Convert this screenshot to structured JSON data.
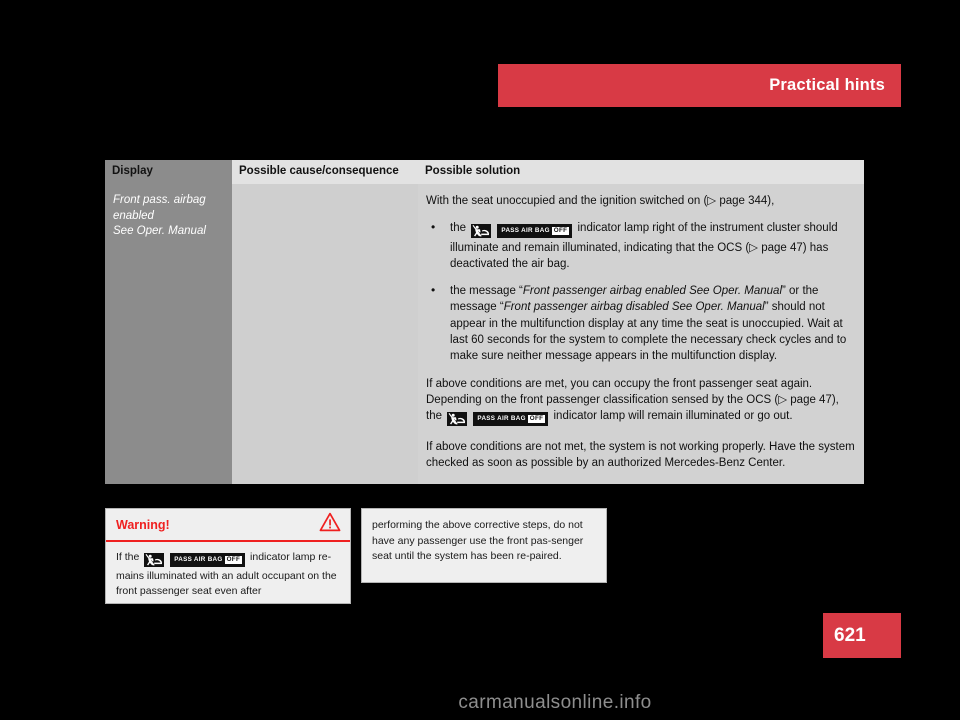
{
  "header": {
    "title": "Practical hints",
    "accent_color": "#d83a45"
  },
  "table": {
    "columns": [
      {
        "key": "display",
        "label": "Display"
      },
      {
        "key": "cause",
        "label": "Possible cause/consequence"
      },
      {
        "key": "solution",
        "label": "Possible solution"
      }
    ],
    "row": {
      "display": "Front pass. airbag enabled\nSee Oper. Manual",
      "display_lines": [
        "Front pass. airbag",
        "enabled",
        "See Oper. Manual"
      ],
      "cause": "",
      "solution": {
        "intro": "With the seat unoccupied and the ignition switched on (▷ page 344),",
        "bullets": [
          {
            "pre": "the",
            "icon": "pass-air-bag-off-indicator-lamp",
            "post": "indicator lamp right of the instrument cluster should illuminate and remain illuminated, indicating that the OCS (▷ page 47) has deactivated the air bag."
          },
          {
            "segments": [
              {
                "text": "the message “",
                "style": "normal"
              },
              {
                "text": "Front passenger airbag enabled See Oper. Manual",
                "style": "italic"
              },
              {
                "text": "” or the message “",
                "style": "normal"
              },
              {
                "text": "Front passenger airbag disabled See Oper. Manual",
                "style": "italic"
              },
              {
                "text": "” should not appear in the multifunction display at any time the seat is unoccupied. Wait at last 60 seconds for the system to complete the necessary check cycles and to make sure neither message appears in the multifunction display.",
                "style": "normal"
              }
            ]
          }
        ],
        "para_2_pre": "If above conditions are met, you can occupy the front passenger seat again. Depending on the front passenger classification sensed by the OCS (▷ page 47), the",
        "para_2_post": "indicator lamp will remain illuminated or go out.",
        "para_3": "If above conditions are not met, the system is not working properly. Have the system checked as soon as possible by an authorized Mercedes-Benz Center."
      }
    }
  },
  "indicator_lamp": {
    "text": "PASS AIR BAG",
    "off_text": "OFF",
    "symbol_name": "passenger-airbag-off-symbol"
  },
  "warning_left": {
    "title": "Warning!",
    "icon": "warning-triangle-icon",
    "body_pre": "If the",
    "body_post": "indicator lamp re-mains illuminated with an adult occupant on the front passenger seat even after",
    "accent_color": "#ef2020"
  },
  "warning_right": {
    "body": "performing the above corrective steps, do not have any passenger use the front pas-senger seat until the system has been re-paired."
  },
  "page": {
    "number": "621"
  },
  "watermark": {
    "text": "carmanualsonline.info"
  }
}
